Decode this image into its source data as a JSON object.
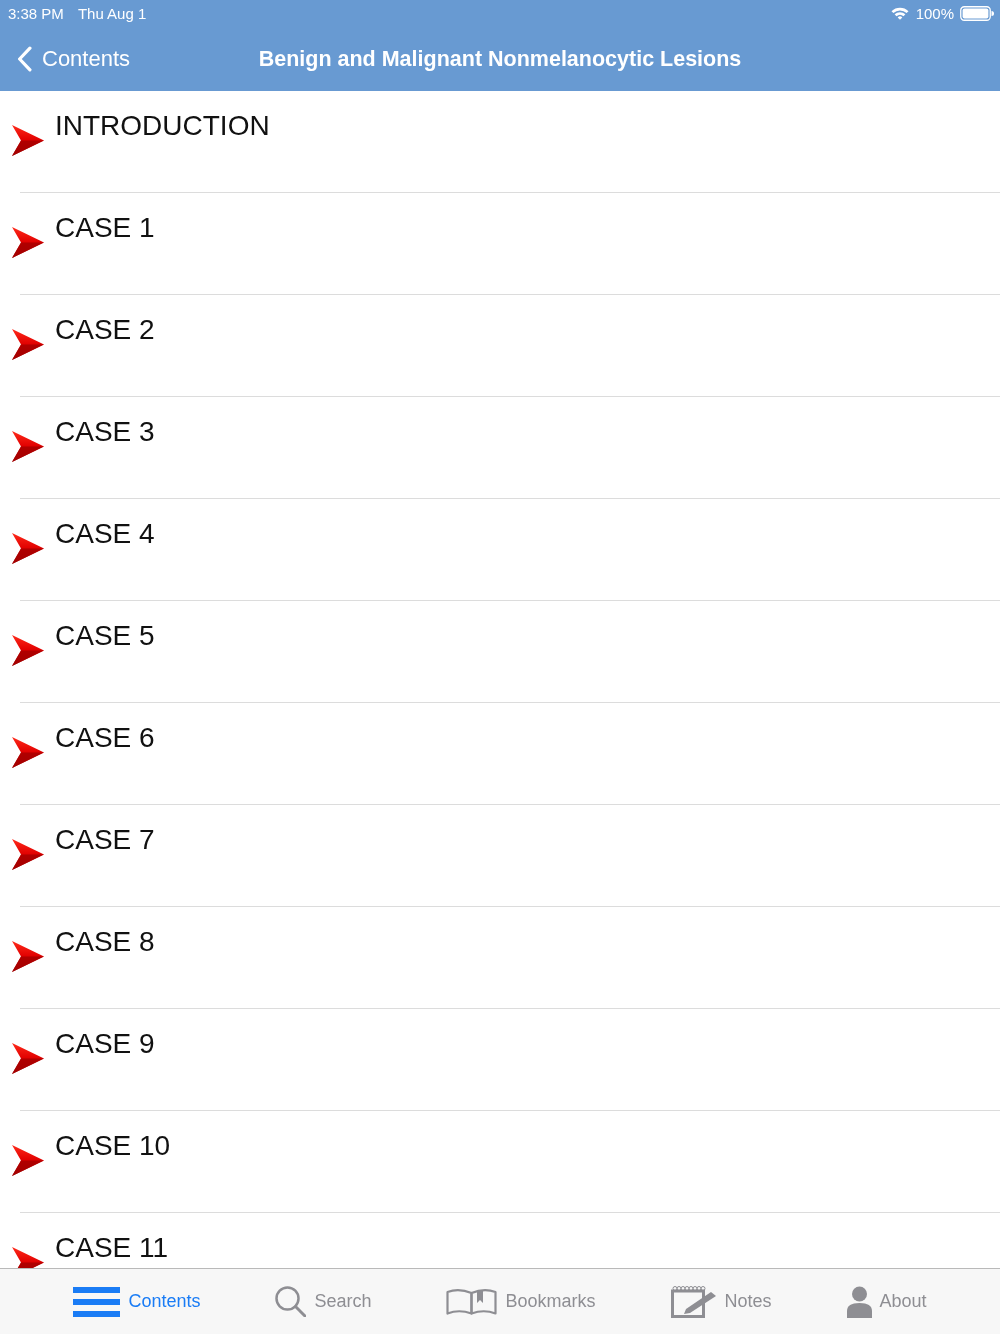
{
  "status_bar": {
    "time": "3:38 PM",
    "date": "Thu Aug 1",
    "battery": "100%"
  },
  "nav_bar": {
    "back_label": "Contents",
    "title": "Benign and Malignant Nonmelanocytic Lesions"
  },
  "contents": [
    {
      "label": "INTRODUCTION"
    },
    {
      "label": "CASE 1"
    },
    {
      "label": "CASE 2"
    },
    {
      "label": "CASE 3"
    },
    {
      "label": "CASE 4"
    },
    {
      "label": "CASE 5"
    },
    {
      "label": "CASE 6"
    },
    {
      "label": "CASE 7"
    },
    {
      "label": "CASE 8"
    },
    {
      "label": "CASE 9"
    },
    {
      "label": "CASE 10"
    },
    {
      "label": "CASE 11"
    }
  ],
  "tab_bar": [
    {
      "label": "Contents",
      "selected": true
    },
    {
      "label": "Search",
      "selected": false
    },
    {
      "label": "Bookmarks",
      "selected": false
    },
    {
      "label": "Notes",
      "selected": false
    },
    {
      "label": "About",
      "selected": false
    }
  ]
}
